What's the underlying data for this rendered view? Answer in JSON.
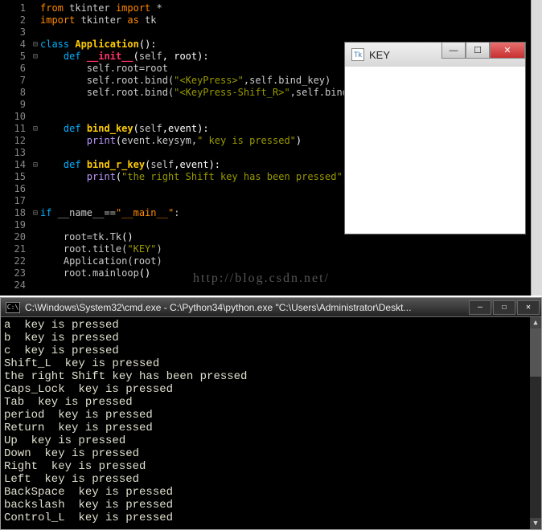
{
  "editor": {
    "gutter": [
      "1",
      "2",
      "3",
      "4",
      "5",
      "6",
      "7",
      "8",
      "9",
      "10",
      "11",
      "12",
      "13",
      "14",
      "15",
      "16",
      "17",
      "18",
      "19",
      "20",
      "21",
      "22",
      "23",
      "24"
    ],
    "fold": [
      "",
      "",
      "",
      "-",
      "-",
      "",
      "",
      "",
      "",
      "",
      "-",
      "",
      "",
      "-",
      "",
      "",
      "",
      "-",
      "",
      "",
      "",
      "",
      "",
      ""
    ],
    "code_tokens": [
      [
        {
          "c": "c-kw2",
          "t": "from"
        },
        {
          "c": "",
          "t": " tkinter "
        },
        {
          "c": "c-kw2",
          "t": "import"
        },
        {
          "c": "",
          "t": " *"
        }
      ],
      [
        {
          "c": "c-kw2",
          "t": "import"
        },
        {
          "c": "",
          "t": " tkinter "
        },
        {
          "c": "c-kw2",
          "t": "as"
        },
        {
          "c": "",
          "t": " tk"
        }
      ],
      [],
      [
        {
          "c": "c-kw",
          "t": "class"
        },
        {
          "c": "",
          "t": " "
        },
        {
          "c": "c-def",
          "t": "Application"
        },
        {
          "c": "c-white",
          "t": "():"
        }
      ],
      [
        {
          "c": "",
          "t": "    "
        },
        {
          "c": "c-kw",
          "t": "def"
        },
        {
          "c": "",
          "t": " "
        },
        {
          "c": "c-pink",
          "t": "__init__"
        },
        {
          "c": "c-white",
          "t": "("
        },
        {
          "c": "c-self",
          "t": "self"
        },
        {
          "c": "c-white",
          "t": ", root):"
        }
      ],
      [
        {
          "c": "",
          "t": "        self.root=root"
        }
      ],
      [
        {
          "c": "",
          "t": "        self.root.bind("
        },
        {
          "c": "c-str",
          "t": "\"<KeyPress>\""
        },
        {
          "c": "",
          "t": ",self.bind_key)"
        }
      ],
      [
        {
          "c": "",
          "t": "        self.root.bind("
        },
        {
          "c": "c-str",
          "t": "\"<KeyPress-Shift_R>\""
        },
        {
          "c": "",
          "t": ",self.bind_r_key)"
        }
      ],
      [],
      [],
      [
        {
          "c": "",
          "t": "    "
        },
        {
          "c": "c-kw",
          "t": "def"
        },
        {
          "c": "",
          "t": " "
        },
        {
          "c": "c-def",
          "t": "bind_key"
        },
        {
          "c": "c-white",
          "t": "("
        },
        {
          "c": "c-self",
          "t": "self"
        },
        {
          "c": "c-white",
          "t": ",event):"
        }
      ],
      [
        {
          "c": "",
          "t": "        "
        },
        {
          "c": "c-pur",
          "t": "print"
        },
        {
          "c": "c-white",
          "t": "("
        },
        {
          "c": "",
          "t": "event.keysym,"
        },
        {
          "c": "c-str",
          "t": "\" key is pressed\""
        },
        {
          "c": "c-white",
          "t": ")"
        }
      ],
      [],
      [
        {
          "c": "",
          "t": "    "
        },
        {
          "c": "c-kw",
          "t": "def"
        },
        {
          "c": "",
          "t": " "
        },
        {
          "c": "c-def",
          "t": "bind_r_key"
        },
        {
          "c": "c-white",
          "t": "("
        },
        {
          "c": "c-self",
          "t": "self"
        },
        {
          "c": "c-white",
          "t": ",event):"
        }
      ],
      [
        {
          "c": "",
          "t": "        "
        },
        {
          "c": "c-pur",
          "t": "print"
        },
        {
          "c": "c-white",
          "t": "("
        },
        {
          "c": "c-str",
          "t": "\"the right Shift key has been pressed\""
        },
        {
          "c": "c-white",
          "t": ")"
        }
      ],
      [],
      [],
      [
        {
          "c": "c-kw",
          "t": "if"
        },
        {
          "c": "",
          "t": " __name__=="
        },
        {
          "c": "c-str2",
          "t": "\"__main__\""
        },
        {
          "c": "",
          "t": ":"
        }
      ],
      [],
      [
        {
          "c": "",
          "t": "    root=tk.Tk"
        },
        {
          "c": "c-white",
          "t": "()"
        }
      ],
      [
        {
          "c": "",
          "t": "    root.title("
        },
        {
          "c": "c-str",
          "t": "\"KEY\""
        },
        {
          "c": "",
          "t": ")"
        }
      ],
      [
        {
          "c": "",
          "t": "    Application(root)"
        }
      ],
      [
        {
          "c": "",
          "t": "    root.mainloop"
        },
        {
          "c": "c-white",
          "t": "()"
        }
      ],
      []
    ],
    "watermark": "http://blog.csdn.net/"
  },
  "keywin": {
    "title": "KEY",
    "buttons": {
      "min": "—",
      "max": "☐",
      "close": "✕"
    }
  },
  "cmd": {
    "title": "C:\\Windows\\System32\\cmd.exe - C:\\Python34\\python.exe  \"C:\\Users\\Administrator\\Deskt...",
    "buttons": {
      "min": "—",
      "max": "☐",
      "close": "✕"
    },
    "lines": [
      "a  key is pressed",
      "b  key is pressed",
      "c  key is pressed",
      "Shift_L  key is pressed",
      "the right Shift key has been pressed",
      "Caps_Lock  key is pressed",
      "Tab  key is pressed",
      "period  key is pressed",
      "Return  key is pressed",
      "Up  key is pressed",
      "Down  key is pressed",
      "Right  key is pressed",
      "Left  key is pressed",
      "BackSpace  key is pressed",
      "backslash  key is pressed",
      "Control_L  key is pressed"
    ]
  }
}
